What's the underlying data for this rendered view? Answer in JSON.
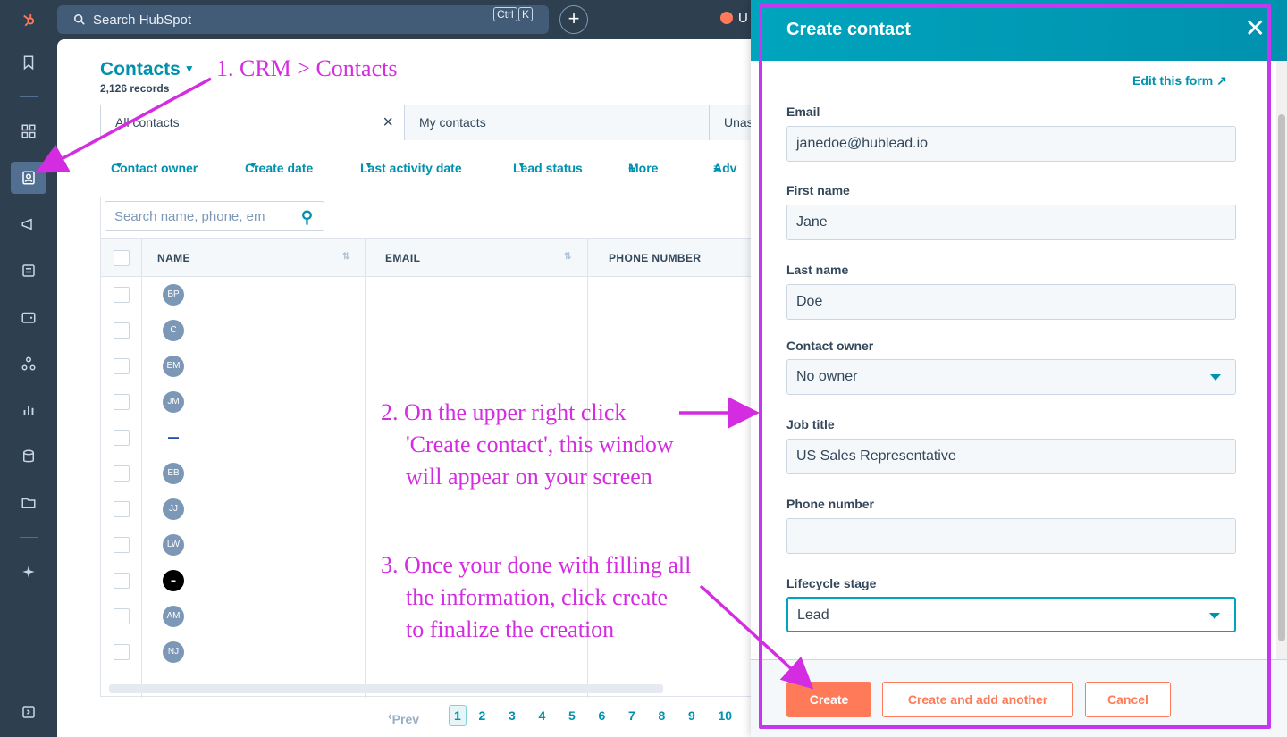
{
  "topbar": {
    "search_placeholder": "Search HubSpot",
    "shortcut_ctrl": "Ctrl",
    "shortcut_k": "K",
    "upgrade_label": "U"
  },
  "contacts": {
    "title": "Contacts",
    "record_count": "2,126 records",
    "tabs": [
      "All contacts",
      "My contacts",
      "Unas"
    ],
    "filters": [
      "Contact owner",
      "Create date",
      "Last activity date",
      "Lead status",
      "More",
      "Adv"
    ],
    "table_search_placeholder": "Search name, phone, em",
    "columns": [
      "NAME",
      "EMAIL",
      "PHONE NUMBER"
    ],
    "rows": [
      {
        "initials": "BP"
      },
      {
        "initials": "C"
      },
      {
        "initials": "EM"
      },
      {
        "initials": "JM"
      },
      {
        "initials": "LOGO"
      },
      {
        "initials": "EB"
      },
      {
        "initials": "JJ"
      },
      {
        "initials": "LW"
      },
      {
        "initials": "DARK"
      },
      {
        "initials": "AM"
      },
      {
        "initials": "NJ"
      }
    ],
    "pager": {
      "prev": "Prev",
      "pages": [
        "1",
        "2",
        "3",
        "4",
        "5",
        "6",
        "7",
        "8",
        "9",
        "10"
      ],
      "current": "1"
    }
  },
  "panel": {
    "title": "Create contact",
    "edit_link": "Edit this form",
    "fields": {
      "email": {
        "label": "Email",
        "value": "janedoe@hublead.io"
      },
      "first_name": {
        "label": "First name",
        "value": "Jane"
      },
      "last_name": {
        "label": "Last name",
        "value": "Doe"
      },
      "contact_owner": {
        "label": "Contact owner",
        "value": "No owner"
      },
      "job_title": {
        "label": "Job title",
        "value": "US Sales Representative"
      },
      "phone": {
        "label": "Phone number",
        "value": ""
      },
      "lifecycle": {
        "label": "Lifecycle stage",
        "value": "Lead"
      }
    },
    "buttons": {
      "create": "Create",
      "create_another": "Create and add another",
      "cancel": "Cancel"
    }
  },
  "annotations": {
    "step1": "1. CRM > Contacts",
    "step2": [
      "2. On the upper right click",
      "'Create contact', this window",
      "will appear on your screen"
    ],
    "step3": [
      "3. Once your done with filling all",
      "the information, click create",
      "to finalize the creation"
    ]
  },
  "colors": {
    "accent": "#0091ae",
    "orange": "#ff7a59",
    "annotation": "#d42ce0",
    "rail": "#2e3f50"
  }
}
